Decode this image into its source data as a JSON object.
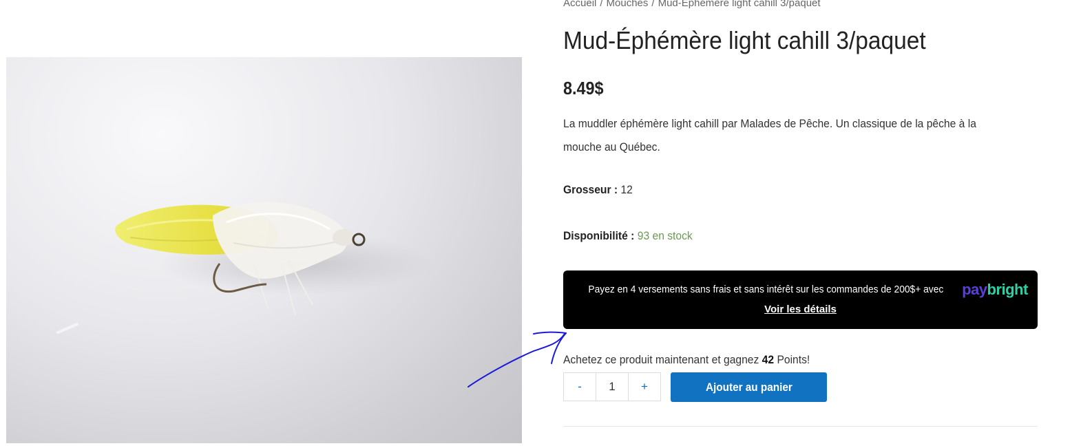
{
  "breadcrumb": {
    "home": "Accueil",
    "separator": "/",
    "category": "Mouches",
    "current": "Mud-Éphémère light cahill 3/paquet"
  },
  "product": {
    "title": "Mud-Éphémère light cahill 3/paquet",
    "price": "8.49$",
    "description": "La muddler éphémère light cahill par Malades de Pêche. Un classique de la pêche à la mouche au Québec.",
    "size_label": "Grosseur :",
    "size_value": "12",
    "availability_label": "Disponibilité :",
    "availability_value": "93 en stock",
    "image_icon": "fly-lure-photo"
  },
  "paybright": {
    "message": "Payez en 4 versements sans frais et sans intérêt sur les commandes de 200$+ avec",
    "brand_pay": "pay",
    "brand_bright": "bright",
    "details_link": "Voir les détails",
    "colors": {
      "background": "#000000",
      "pay": "#5c3fd6",
      "bright": "#2ed0a4"
    }
  },
  "points": {
    "prefix": "Achetez ce produit maintenant et gagnez",
    "amount": "42",
    "suffix": "Points!"
  },
  "cart": {
    "minus_label": "-",
    "quantity": "1",
    "plus_label": "+",
    "add_button": "Ajouter au panier",
    "accent_color": "#1272c2"
  },
  "annotation": {
    "type": "hand-drawn-arrow",
    "color": "#1a1adb"
  }
}
